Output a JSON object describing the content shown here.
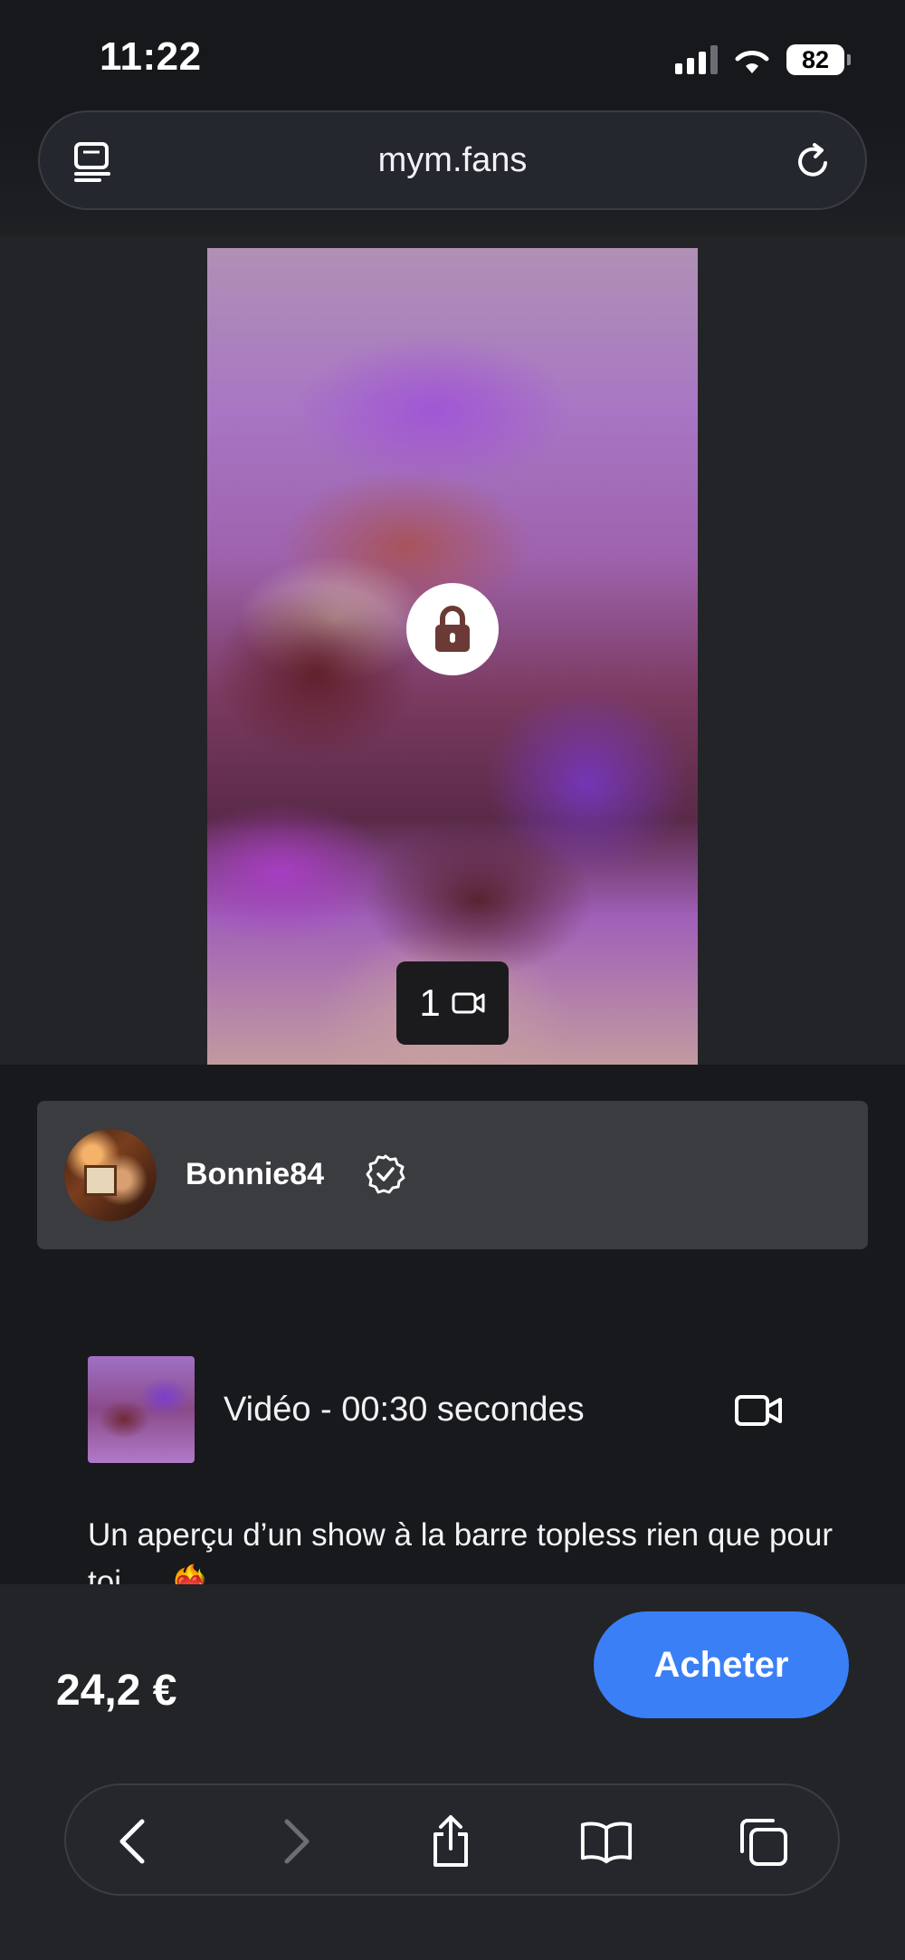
{
  "status_bar": {
    "time": "11:22",
    "battery": "82"
  },
  "browser": {
    "url": "mym.fans"
  },
  "media": {
    "count": "1"
  },
  "creator": {
    "name": "Bonnie84"
  },
  "post": {
    "video_meta": "Vidéo - 00:30 secondes",
    "caption": "Un aperçu d’un show à la barre topless rien que pour toi … ❤️‍🔥"
  },
  "purchase": {
    "price": "24,2 €",
    "buy_label": "Acheter",
    "accent_color": "#3a7ff6"
  },
  "icons": [
    "reader-icon",
    "reload-icon",
    "lock-icon",
    "video-camera-icon",
    "verified-badge-icon",
    "back-icon",
    "forward-icon",
    "share-icon",
    "bookmarks-icon",
    "tabs-icon"
  ]
}
